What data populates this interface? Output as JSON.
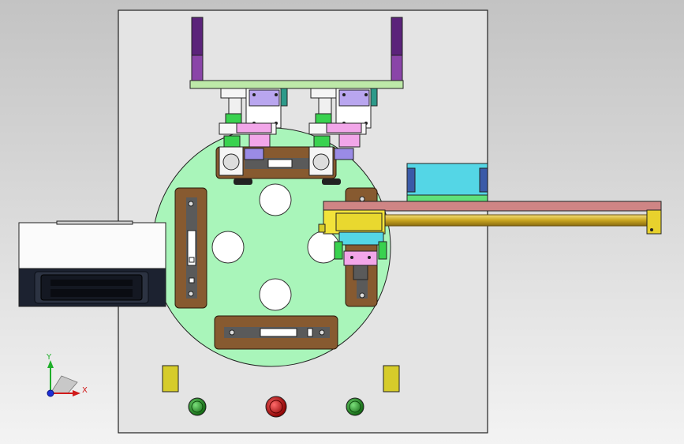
{
  "triad": {
    "y_label": "Y",
    "x_label": "X"
  },
  "colors": {
    "background_top": "#c2c2c2",
    "background_bottom": "#f0f0f0",
    "base_plate": "#e4e4e4",
    "turntable": "#a9f5ba",
    "fixture_wood": "#875a30",
    "fixture_slot": "#5a5a5a",
    "frame_purple": "#6a2a80",
    "frame_green": "#bde9a8",
    "motor_pink": "#f2a6e9",
    "clamp_green": "#39d24f",
    "cylinder_gold": "#d3b52b",
    "rail_rose": "#cf8585",
    "cyan_block": "#54d6e6",
    "yellow_sensor": "#d6cc2a",
    "button_green": "#2a9a2a",
    "button_red": "#c21818",
    "feeder_body": "#ffffff",
    "feeder_dark": "#1c2230",
    "axis_x": "#d11b1b",
    "axis_y": "#1fae2a",
    "axis_z": "#1d2fd6"
  },
  "components": {
    "turntable_holes": 4,
    "fixtures": 4,
    "indicator_lights": [
      "green",
      "red",
      "green"
    ],
    "sensors": 2,
    "pick_heads": 2
  }
}
